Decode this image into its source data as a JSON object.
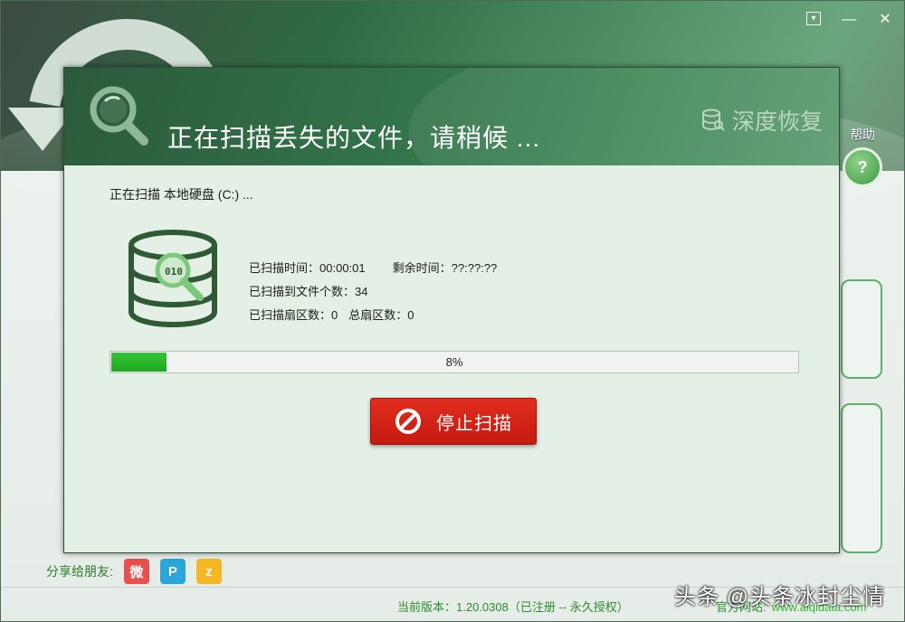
{
  "window": {
    "controls": {
      "menu": "▾",
      "minimize": "—",
      "close": "✕"
    }
  },
  "help": {
    "label": "帮助",
    "icon_text": "?"
  },
  "share": {
    "label": "分享给朋友:",
    "icons": [
      {
        "name": "weibo-icon",
        "glyph": "微"
      },
      {
        "name": "qzone-icon",
        "glyph": "P"
      },
      {
        "name": "qq-icon",
        "glyph": "z"
      }
    ]
  },
  "footer": {
    "version": "当前版本：1.20.0308（已注册 -- 永久授权）",
    "website_label": "官方网站:",
    "website_url": "www.aiqidata.com"
  },
  "watermark": "头条 @头条冰封尘情",
  "dialog": {
    "title": "正在扫描丢失的文件，请稍候 ...",
    "brand": "深度恢复",
    "scan_target": "正在扫描  本地硬盘 (C:) ...",
    "stats": {
      "elapsed_label": "已扫描时间：",
      "elapsed_value": "00:00:01",
      "remaining_label": "剩余时间：",
      "remaining_value": "??:??:??",
      "files_label": "已扫描到文件个数：",
      "files_value": "34",
      "sectors_label": "已扫描扇区数：",
      "sectors_value": "0",
      "total_sectors_label": "总扇区数：",
      "total_sectors_value": "0"
    },
    "progress": {
      "percent": 8,
      "label": "8%"
    },
    "stop_button": "停止扫描"
  },
  "colors": {
    "header_green": "#33744a",
    "progress_green": "#1fa81f",
    "stop_red": "#c61a10"
  }
}
